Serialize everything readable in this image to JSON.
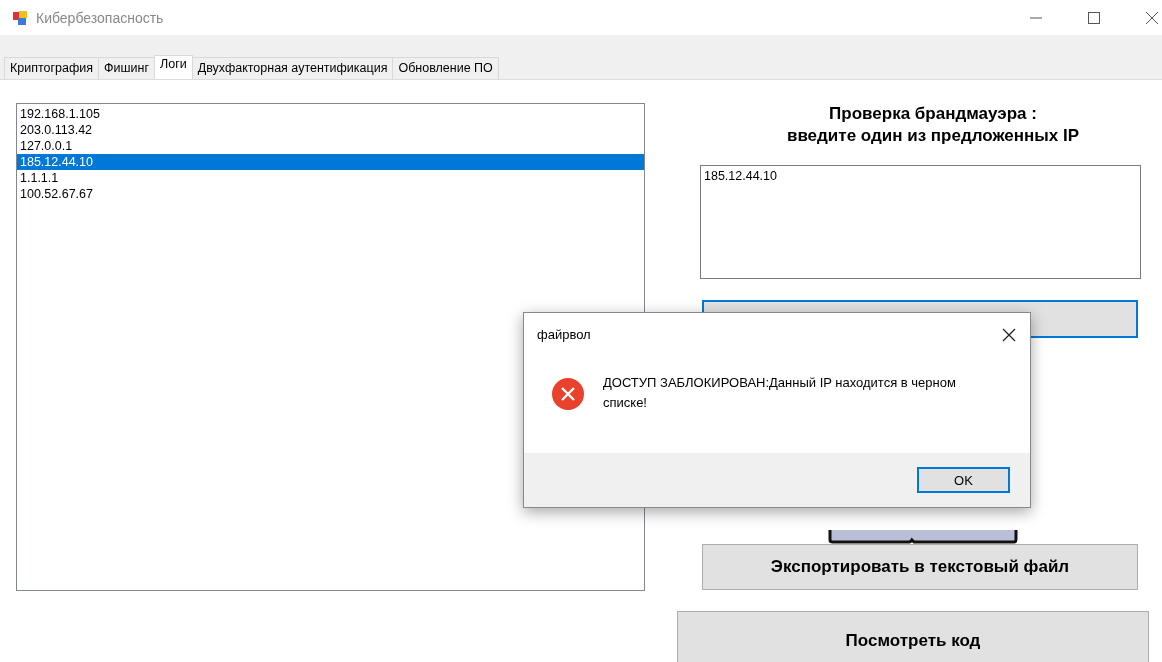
{
  "window": {
    "title": "Кибербезопасность"
  },
  "tabs": [
    {
      "label": "Криптография",
      "selected": false
    },
    {
      "label": "Фишинг",
      "selected": false
    },
    {
      "label": "Логи",
      "selected": true
    },
    {
      "label": "Двухфакторная аутентификация",
      "selected": false
    },
    {
      "label": "Обновление ПО",
      "selected": false
    }
  ],
  "log_list": {
    "items": [
      {
        "text": "192.168.1.105",
        "selected": false
      },
      {
        "text": "203.0.113.42",
        "selected": false
      },
      {
        "text": "127.0.0.1",
        "selected": false
      },
      {
        "text": "185.12.44.10",
        "selected": true
      },
      {
        "text": "1.1.1.1",
        "selected": false
      },
      {
        "text": "100.52.67.67",
        "selected": false
      }
    ]
  },
  "firewall": {
    "heading": "Проверка брандмауэра :\nвведите один из предложенных IP",
    "ip_input": {
      "value": "185.12.44.10"
    }
  },
  "export_button": "Экспортировать в текстовый файл",
  "view_code_button": "Посмотреть код",
  "dialog": {
    "title": "файрвол",
    "kind": "error",
    "message": "ДОСТУП ЗАБЛОКИРОВАН:Данный IP находится в черном списке!",
    "ok_button": "OK"
  }
}
